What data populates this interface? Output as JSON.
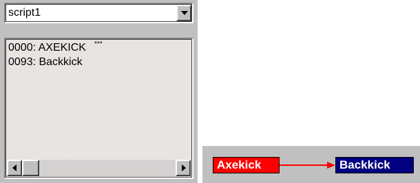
{
  "script_selector": {
    "selected": "script1"
  },
  "script_list": {
    "items": [
      {
        "label": "0000: AXEKICK",
        "marker": "***"
      },
      {
        "label": "0093: Backkick",
        "marker": ""
      }
    ]
  },
  "flow_diagram": {
    "nodes": [
      {
        "label": "Axekick"
      },
      {
        "label": "Backkick"
      }
    ]
  },
  "icons": {
    "dropdown": "chevron-down-icon",
    "scroll_left": "scroll-left-arrow-icon",
    "scroll_right": "scroll-right-arrow-icon",
    "connector": "arrow-right-icon"
  },
  "colors": {
    "panel_bg": "#c0c0c0",
    "list_bg": "#e8e4e2",
    "start_node": "#ff0000",
    "end_node": "#000080",
    "connector": "#ff0000",
    "node_text": "#ffffff"
  }
}
